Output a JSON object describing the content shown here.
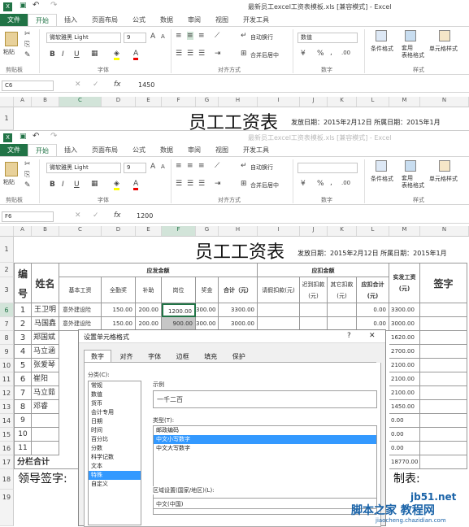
{
  "window": {
    "title_1": "最新员工excel工资表模板.xls [兼容模式] - Excel",
    "title_2": "最新员工excel工资表模板.xls [兼容模式] - Excel"
  },
  "tabs": [
    "文件",
    "开始",
    "插入",
    "页面布局",
    "公式",
    "数据",
    "审阅",
    "视图",
    "开发工具"
  ],
  "ribbon": {
    "paste": "粘贴",
    "clipboard": "剪贴板",
    "font_name": "微软雅黑 Light",
    "font_size": "9",
    "font_group": "字体",
    "align_group": "对齐方式",
    "number_group": "数字",
    "style_group": "样式",
    "wrap": "自动换行",
    "merge": "合并后居中",
    "num_format": "数值",
    "bold": "B",
    "italic": "I",
    "underline": "U",
    "font_color_glyph": "A",
    "percent": "%",
    "comma": ",",
    "cond_format": "条件格式",
    "table_format": "套用\n表格格式",
    "cell_style": "单元格样式"
  },
  "formula_bar_1": {
    "namebox": "C6",
    "fx": "fx",
    "value": "1450"
  },
  "formula_bar_2": {
    "namebox": "F6",
    "fx": "fx",
    "value": "1200"
  },
  "columns": [
    "A",
    "B",
    "C",
    "D",
    "E",
    "F",
    "G",
    "H",
    "I",
    "J",
    "K",
    "L",
    "M",
    "N"
  ],
  "sheet": {
    "title": "员工工资表",
    "issue": "发放日期：2015年2月12日 所属日期：2015年1月",
    "issue_short": "发放日期：2015年2月12日 所属日期：2015年1月",
    "header_bianhao": "编号",
    "header_name": "姓名",
    "header_yingfa": "应发金额",
    "header_yingkou": "应扣金额",
    "header_shifa": "实发工资(元)",
    "header_sign": "签字",
    "subheaders": [
      "基本工资",
      "全勤奖",
      "补助",
      "岗位",
      "奖金",
      "合计（元）",
      "请假扣款(元)",
      "迟到扣款(元)",
      "其它扣款(元)",
      "应扣合计(元)"
    ],
    "rows": [
      {
        "no": "1",
        "name": "王卫明",
        "basic": "意外建设险",
        "full": "150.00",
        "sub": "200.00",
        "post": "1200.00",
        "bonus": "300.00",
        "total": "3300.00",
        "ded": "0.00",
        "net": "3300.00"
      },
      {
        "no": "2",
        "name": "马国鑫",
        "basic": "意外建设险",
        "full": "150.00",
        "sub": "200.00",
        "post": "900.00",
        "bonus": "300.00",
        "total": "3000.00",
        "ded": "0.00",
        "net": "3000.00"
      },
      {
        "no": "3",
        "name": "郑国斌",
        "net": "1620.00"
      },
      {
        "no": "4",
        "name": "马立涵",
        "net": "2700.00"
      },
      {
        "no": "5",
        "name": "张爱琴",
        "net": "2100.00"
      },
      {
        "no": "6",
        "name": "崔阳",
        "net": "2100.00"
      },
      {
        "no": "7",
        "name": "马立茹",
        "net": "2100.00"
      },
      {
        "no": "8",
        "name": "邓睿",
        "net": "1450.00"
      },
      {
        "no": "9",
        "name": "",
        "net": "0.00"
      },
      {
        "no": "10",
        "name": "",
        "net": "0.00"
      },
      {
        "no": "11",
        "name": "",
        "net": "0.00"
      }
    ],
    "subtotal_label": "分栏合计",
    "subtotal_net": "18770.00",
    "leader_sign": "领导签字:",
    "maker": "制表:",
    "row_numbers": [
      "1",
      "2",
      "3",
      "6",
      "7",
      "8",
      "9",
      "10",
      "11",
      "12",
      "13",
      "14",
      "15",
      "16",
      "17",
      "18",
      "19"
    ]
  },
  "dialog": {
    "title": "设置单元格格式",
    "help": "?",
    "close": "✕",
    "tabs": [
      "数字",
      "对齐",
      "字体",
      "边框",
      "填充",
      "保护"
    ],
    "category_label": "分类(C):",
    "categories": [
      "常规",
      "数值",
      "货币",
      "会计专用",
      "日期",
      "时间",
      "百分比",
      "分数",
      "科学记数",
      "文本",
      "特殊",
      "自定义"
    ],
    "selected_category": "特殊",
    "sample_label": "示例",
    "sample_value": "一千二百",
    "type_label": "类型(T):",
    "types": [
      "邮政编码",
      "中文小写数字",
      "中文大写数字"
    ],
    "selected_type": "中文小写数字",
    "locale_label": "区域设置(国家/地区)(L):",
    "locale_value": "中文(中国)"
  },
  "watermark": {
    "site": "jb51.net",
    "text": "脚本之家 教程网",
    "url": "jiaocheng.chazidian.com"
  }
}
